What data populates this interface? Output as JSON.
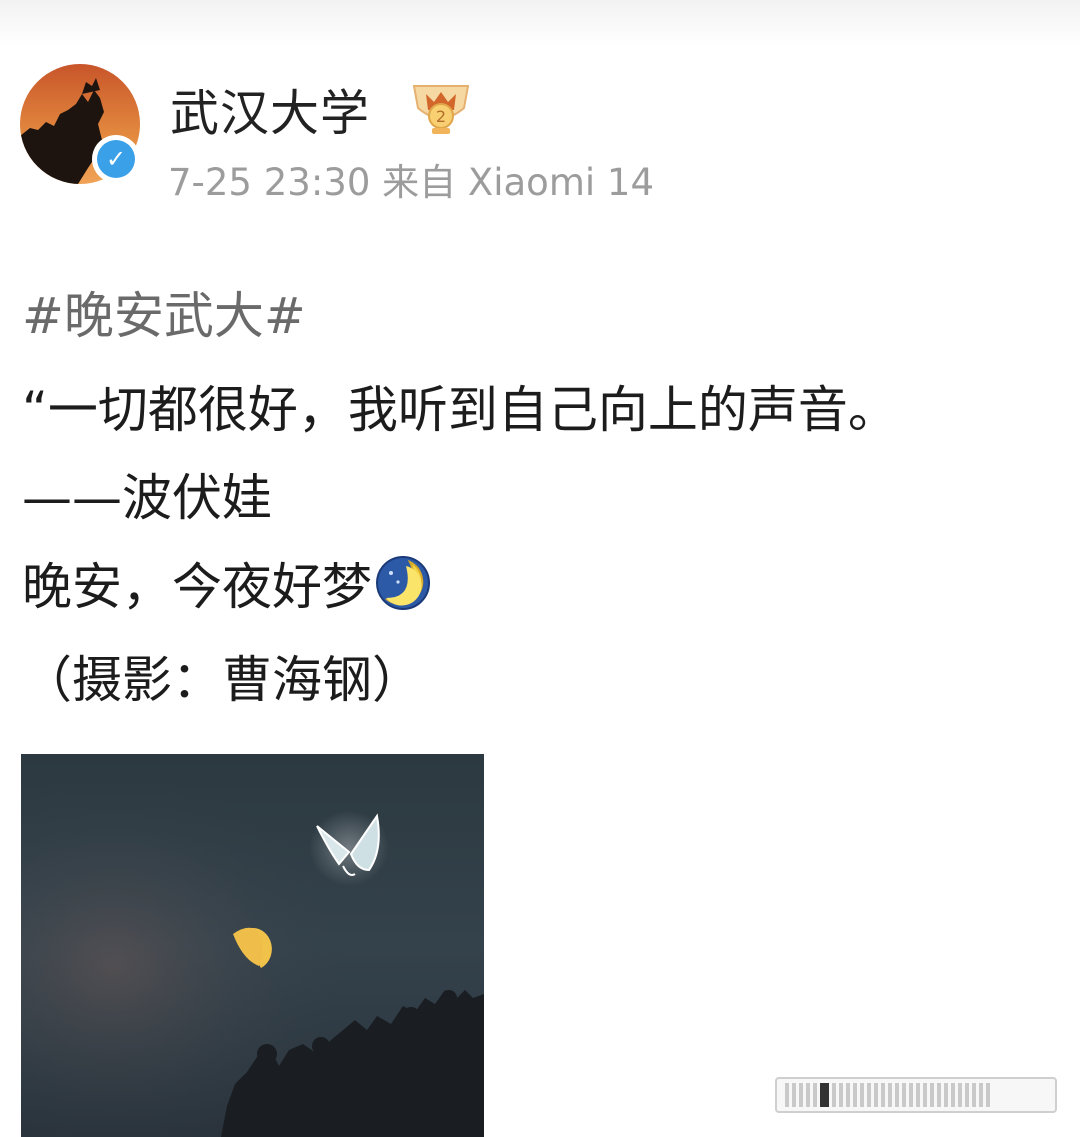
{
  "post": {
    "author": {
      "name": "武汉大学",
      "verified": true,
      "badge_icon": "trophy-rank-icon"
    },
    "meta": "7-25 23:30 来自 Xiaomi 14",
    "lines": {
      "hashtag": "#晚安武大#",
      "quote": "“一切都很好，我听到自己向上的声音。",
      "author_line": "——波伏娃",
      "goodnight": "晚安，今夜好梦",
      "credit": "（摄影：曹海钢）"
    },
    "emoji": "moon-emoji",
    "photo": {
      "subjects": [
        "butterfly-glow",
        "half-moon",
        "tree-silhouette"
      ]
    }
  },
  "colors": {
    "text": "#1c1c1c",
    "hashtag": "#6a6a6a",
    "meta": "#9c9c9c",
    "verified": "#3aa0e8",
    "night_sky": "#303c45",
    "moon": "#f1c24a"
  }
}
